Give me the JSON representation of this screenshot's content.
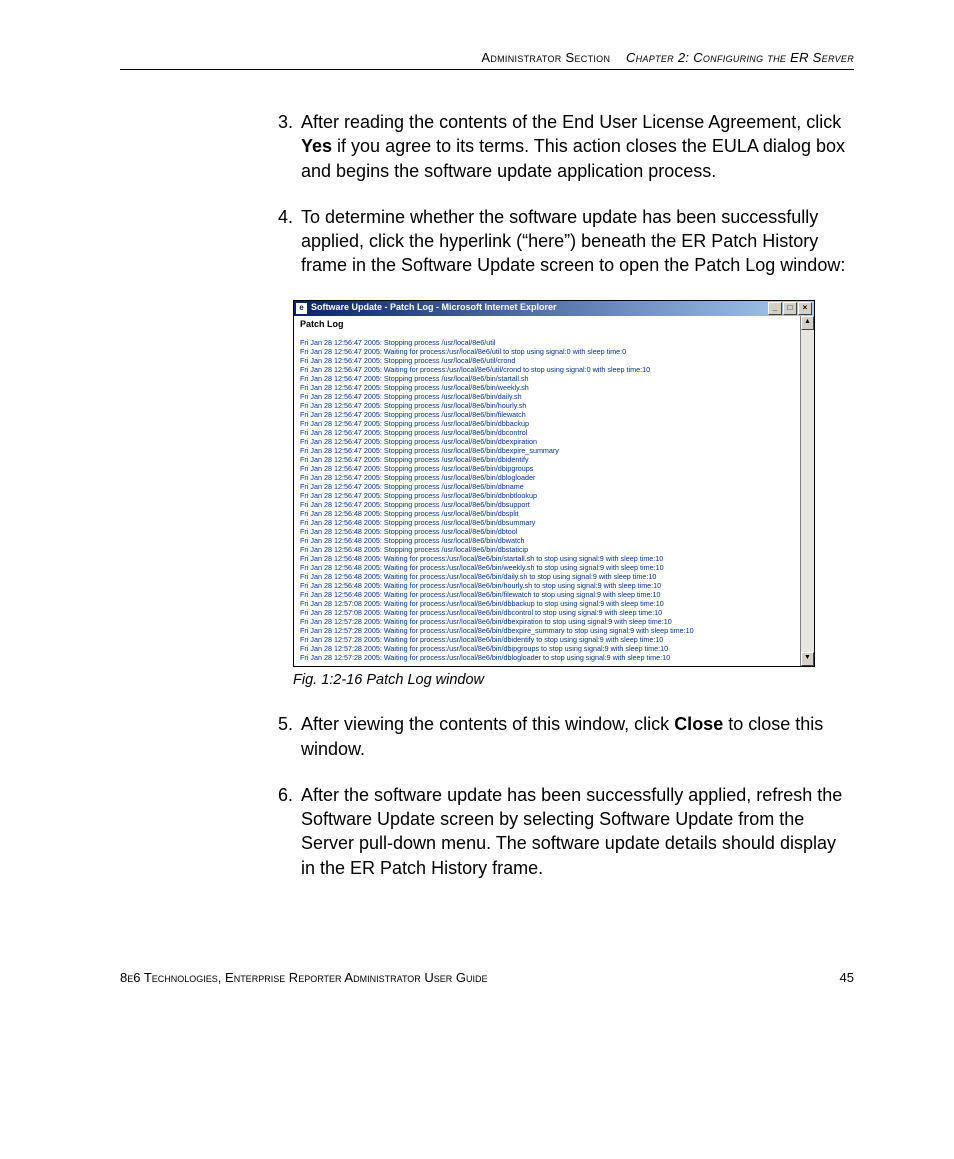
{
  "header": {
    "section": "Administrator Section",
    "chapter": "Chapter 2: Configuring the ER Server"
  },
  "steps": {
    "s3": {
      "num": "3.",
      "text_a": "After reading the contents of the End User License Agreement, click ",
      "bold": "Yes",
      "text_b": " if you agree to its terms. This action closes the EULA dialog box and begins the software update application process."
    },
    "s4": {
      "num": "4.",
      "text": "To determine whether the software update has been successfully applied, click the hyperlink (“here”) beneath the ER Patch History frame in the Software Update screen to open the Patch Log window:"
    },
    "s5": {
      "num": "5.",
      "text_a": "After viewing the contents of this window, click ",
      "bold": "Close",
      "text_b": " to close this window."
    },
    "s6": {
      "num": "6.",
      "text": "After the software update has been successfully applied, refresh the Software Update screen by selecting Software Update from the Server pull-down menu. The software update details should display in the ER Patch History frame."
    }
  },
  "figure": {
    "caption": "Fig. 1:2-16  Patch Log window",
    "window_title": "Software Update - Patch Log - Microsoft Internet Explorer",
    "patch_log_label": "Patch Log",
    "minimize": "_",
    "maximize": "□",
    "close": "×",
    "scroll_up": "▲",
    "scroll_down": "▼",
    "log_lines": [
      "Fri Jan 28 12:56:47 2005: Stopping process /usr/local/8e6/util",
      "Fri Jan 28 12:56:47 2005: Waiting for process:/usr/local/8e6/util to stop using signal:0 with sleep time:0",
      "Fri Jan 28 12:56:47 2005: Stopping process /usr/local/8e6/util/crond",
      "Fri Jan 28 12:56:47 2005: Waiting for process:/usr/local/8e6/util/crond to stop using signal:0 with sleep time:10",
      "Fri Jan 28 12:56:47 2005: Stopping process /usr/local/8e6/bin/startall.sh",
      "Fri Jan 28 12:56:47 2005: Stopping process /usr/local/8e6/bin/weekly.sh",
      "Fri Jan 28 12:56:47 2005: Stopping process /usr/local/8e6/bin/daily.sh",
      "Fri Jan 28 12:56:47 2005: Stopping process /usr/local/8e6/bin/hourly.sh",
      "Fri Jan 28 12:56:47 2005: Stopping process /usr/local/8e6/bin/filewatch",
      "Fri Jan 28 12:56:47 2005: Stopping process /usr/local/8e6/bin/dbbackup",
      "Fri Jan 28 12:56:47 2005: Stopping process /usr/local/8e6/bin/dbcontrol",
      "Fri Jan 28 12:56:47 2005: Stopping process /usr/local/8e6/bin/dbexpiration",
      "Fri Jan 28 12:56:47 2005: Stopping process /usr/local/8e6/bin/dbexpire_summary",
      "Fri Jan 28 12:56:47 2005: Stopping process /usr/local/8e6/bin/dbidentify",
      "Fri Jan 28 12:56:47 2005: Stopping process /usr/local/8e6/bin/dbipgroups",
      "Fri Jan 28 12:56:47 2005: Stopping process /usr/local/8e6/bin/dblogloader",
      "Fri Jan 28 12:56:47 2005: Stopping process /usr/local/8e6/bin/dbname",
      "Fri Jan 28 12:56:47 2005: Stopping process /usr/local/8e6/bin/dbnbtlookup",
      "Fri Jan 28 12:56:47 2005: Stopping process /usr/local/8e6/bin/dbsupport",
      "Fri Jan 28 12:56:48 2005: Stopping process /usr/local/8e6/bin/dbsplit",
      "Fri Jan 28 12:56:48 2005: Stopping process /usr/local/8e6/bin/dbsummary",
      "Fri Jan 28 12:56:48 2005: Stopping process /usr/local/8e6/bin/dbtool",
      "Fri Jan 28 12:56:48 2005: Stopping process /usr/local/8e6/bin/dbwatch",
      "Fri Jan 28 12:56:48 2005: Stopping process /usr/local/8e6/bin/dbstaticip",
      "Fri Jan 28 12:56:48 2005: Waiting for process:/usr/local/8e6/bin/startall.sh to stop using signal:9 with sleep time:10",
      "Fri Jan 28 12:56:48 2005: Waiting for process:/usr/local/8e6/bin/weekly.sh to stop using signal:9 with sleep time:10",
      "Fri Jan 28 12:56:48 2005: Waiting for process:/usr/local/8e6/bin/daily.sh to stop using signal:9 with sleep time:10",
      "Fri Jan 28 12:56:48 2005: Waiting for process:/usr/local/8e6/bin/hourly.sh to stop using signal:9 with sleep time:10",
      "Fri Jan 28 12:56:48 2005: Waiting for process:/usr/local/8e6/bin/filewatch to stop using signal:9 with sleep time:10",
      "Fri Jan 28 12:57:08 2005: Waiting for process:/usr/local/8e6/bin/dbbackup to stop using signal:9 with sleep time:10",
      "Fri Jan 28 12:57:08 2005: Waiting for process:/usr/local/8e6/bin/dbcontrol to stop using signal:9 with sleep time:10",
      "Fri Jan 28 12:57:28 2005: Waiting for process:/usr/local/8e6/bin/dbexpiration to stop using signal:9 with sleep time:10",
      "Fri Jan 28 12:57:28 2005: Waiting for process:/usr/local/8e6/bin/dbexpire_summary to stop using signal:9 with sleep time:10",
      "Fri Jan 28 12:57:28 2005: Waiting for process:/usr/local/8e6/bin/dbidentify to stop using signal:9 with sleep time:10",
      "Fri Jan 28 12:57:28 2005: Waiting for process:/usr/local/8e6/bin/dbipgroups to stop using signal:9 with sleep time:10",
      "Fri Jan 28 12:57:28 2005: Waiting for process:/usr/local/8e6/bin/dblogloader to stop using signal:9 with sleep time:10"
    ]
  },
  "footer": {
    "left": "8e6 Technologies, Enterprise Reporter Administrator User Guide",
    "page": "45"
  }
}
